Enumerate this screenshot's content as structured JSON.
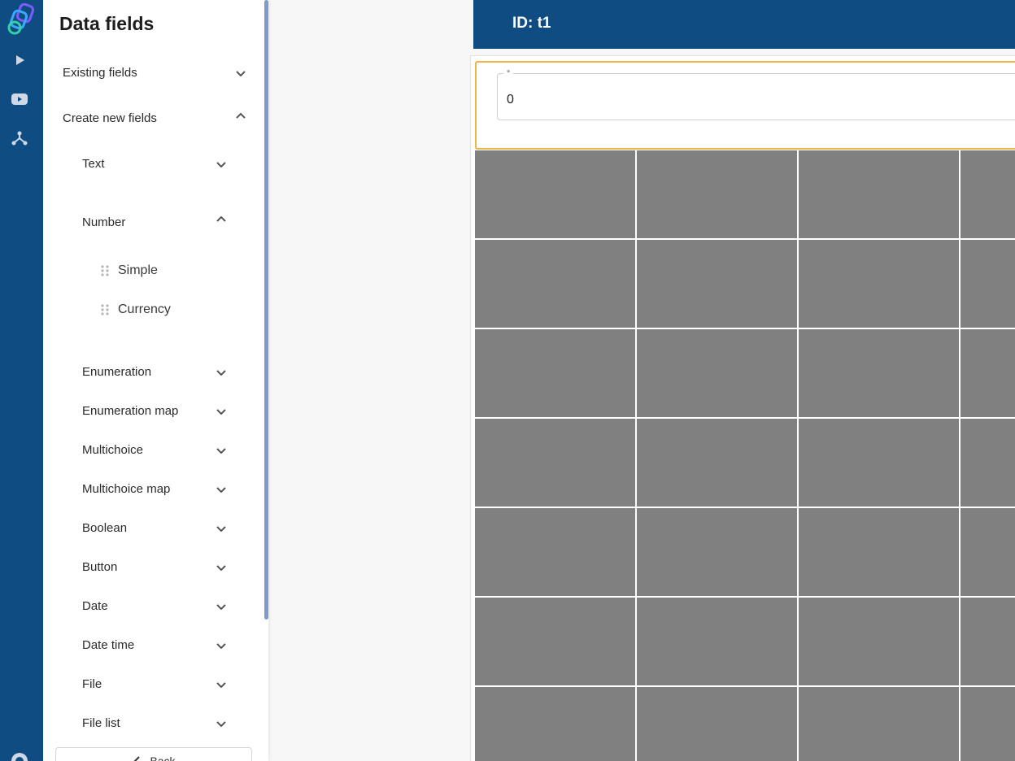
{
  "panel": {
    "title": "Data fields",
    "existing_fields": "Existing fields",
    "create_new_fields": "Create new fields",
    "groups": {
      "text": "Text",
      "number": "Number",
      "enumeration": "Enumeration",
      "enumeration_map": "Enumeration map",
      "multichoice": "Multichoice",
      "multichoice_map": "Multichoice map",
      "boolean": "Boolean",
      "button": "Button",
      "date": "Date",
      "date_time": "Date time",
      "file": "File",
      "file_list": "File list"
    },
    "number_items": [
      "Simple",
      "Currency"
    ],
    "back_label": "Back"
  },
  "header": {
    "title": "ID: t1"
  },
  "field": {
    "label": "*",
    "value": "0"
  },
  "colors": {
    "brand": "#0f4c81",
    "selection": "#f0b24a",
    "grid_cell": "#808080"
  },
  "icons": {
    "rail": [
      "app-logo-icon",
      "play-icon",
      "video-icon",
      "workflow-icon",
      "help-icon"
    ]
  }
}
